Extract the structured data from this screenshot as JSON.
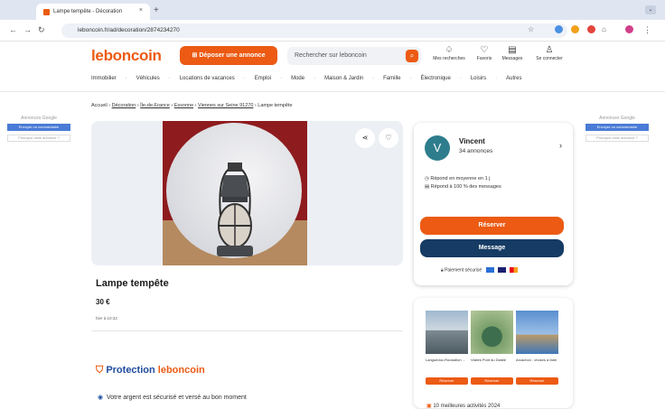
{
  "browser": {
    "tab_title": "Lampe tempête - Décoration",
    "tab_close": "×",
    "new_tab": "+",
    "url": "leboncoin.fr/ad/decoration/2874234270"
  },
  "header": {
    "logo": "leboncoin",
    "post_button": "⊞ Déposer une annonce",
    "search_placeholder": "Rechercher sur leboncoin",
    "icons": [
      {
        "label": "Mes recherches",
        "glyph": "♤"
      },
      {
        "label": "Favoris",
        "glyph": "♡"
      },
      {
        "label": "Messages",
        "glyph": "▤"
      },
      {
        "label": "Se connecter",
        "glyph": "♙"
      }
    ],
    "categories": [
      "Immobilier",
      "Véhicules",
      "Locations de vacances",
      "Emploi",
      "Mode",
      "Maison & Jardin",
      "Famille",
      "Électronique",
      "Loisirs",
      "Autres"
    ]
  },
  "ads": {
    "label": "Annonces Google",
    "left_button": "Envoyer un commentaire",
    "left_link": "Pourquoi cette annonce ?",
    "right_button": "Envoyer un commentaire",
    "right_link": "Pourquoi cette annonce ?"
  },
  "breadcrumb": [
    "Accueil",
    "Décoration",
    "Île-de-France",
    "Essonne",
    "Viennes sur Seine 91270",
    "Lampe tempête"
  ],
  "listing": {
    "title": "Lampe tempête",
    "price": "30 €",
    "date": "hier à 10:33"
  },
  "protection": {
    "title_a": "Protection",
    "title_b": "leboncoin",
    "line": "Votre argent est sécurisé et versé au bon moment"
  },
  "seller": {
    "initial": "V",
    "name": "Vincent",
    "count": "34 annonces",
    "resp1": "Répond en moyenne en 1 j",
    "resp2": "Répond à 100 % des messages",
    "reserve": "Réserver",
    "message": "Message",
    "payment": "Paiement sécurisé"
  },
  "promo": {
    "cards": [
      {
        "text": "Languedoc-Roussillon ...",
        "button": "Réserver"
      },
      {
        "text": "Visites Pont du Diable",
        "button": "Réserver"
      },
      {
        "text": "Arcachon : choses à faire",
        "button": "Réserver"
      }
    ],
    "bottom": "10 meilleures activités 2024"
  }
}
